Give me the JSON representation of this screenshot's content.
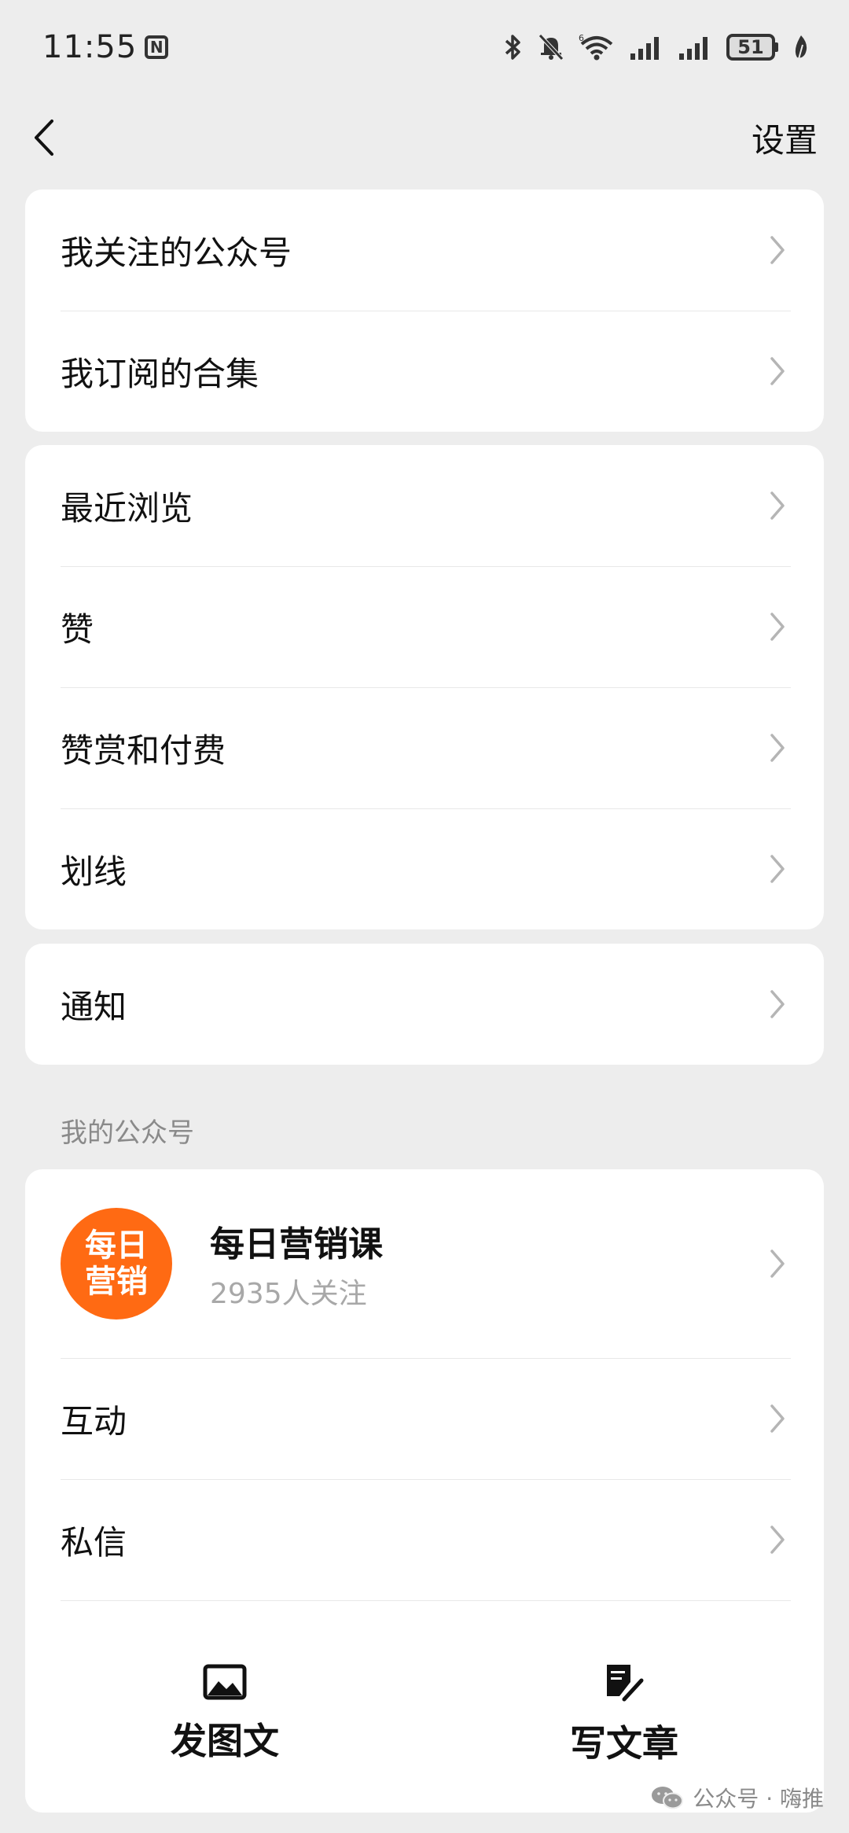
{
  "status_bar": {
    "time": "11:55",
    "battery": "51"
  },
  "nav": {
    "settings_label": "设置"
  },
  "group1": [
    {
      "label": "我关注的公众号"
    },
    {
      "label": "我订阅的合集"
    }
  ],
  "group2": [
    {
      "label": "最近浏览"
    },
    {
      "label": "赞"
    },
    {
      "label": "赞赏和付费"
    },
    {
      "label": "划线"
    }
  ],
  "group3": [
    {
      "label": "通知"
    }
  ],
  "my_accounts": {
    "section_title": "我的公众号",
    "account": {
      "avatar_line1": "每日",
      "avatar_line2": "营销",
      "name": "每日营销课",
      "followers": "2935人关注"
    },
    "items": [
      {
        "label": "互动"
      },
      {
        "label": "私信"
      }
    ],
    "actions": [
      {
        "label": "发图文",
        "icon": "image-icon"
      },
      {
        "label": "写文章",
        "icon": "edit-document-icon"
      }
    ]
  },
  "watermark": {
    "text": "公众号 · 嗨推"
  },
  "colors": {
    "background": "#ededed",
    "card": "#ffffff",
    "avatar": "#ff6a13",
    "secondary_text": "#a8a8a8"
  }
}
